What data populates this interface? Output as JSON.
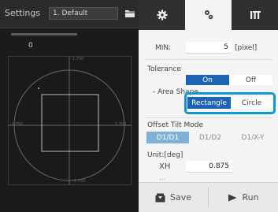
{
  "left_panel": {
    "title": "Settings",
    "preset_value": "1. Default",
    "readout_value": "0",
    "axis_ticks": {
      "top": "1.750",
      "left": "-1.750",
      "right": "1.750",
      "bottom": "-1.750"
    }
  },
  "tabs": [
    {
      "icon": "gear-icon"
    },
    {
      "icon": "sliders-icon"
    },
    {
      "icon": "io-icon"
    }
  ],
  "settings": {
    "min_label": "MIN:",
    "min_value": "5",
    "min_unit": "[pixel]",
    "tolerance_label": "Tolerance",
    "tolerance_on": "On",
    "tolerance_off": "Off",
    "area_shape_label": "- Area Shape",
    "shape_rectangle": "Rectangle",
    "shape_circle": "Circle",
    "offset_tilt_label": "Offset Tilt Mode",
    "offset_opt1": "D1/D1",
    "offset_opt2": "D1/D2",
    "offset_opt3": "D1/X-Y",
    "unit_label": "Unit:[deg]",
    "xh_label": "XH",
    "xh_value": "0.875",
    "next_label": "..."
  },
  "bottom": {
    "save_label": "Save",
    "run_label": "Run"
  },
  "colors": {
    "accent": "#1c63b7",
    "highlight": "#0e99d6",
    "dark_bg": "#1b1b1b",
    "panel_bg": "#f4f4f4"
  }
}
